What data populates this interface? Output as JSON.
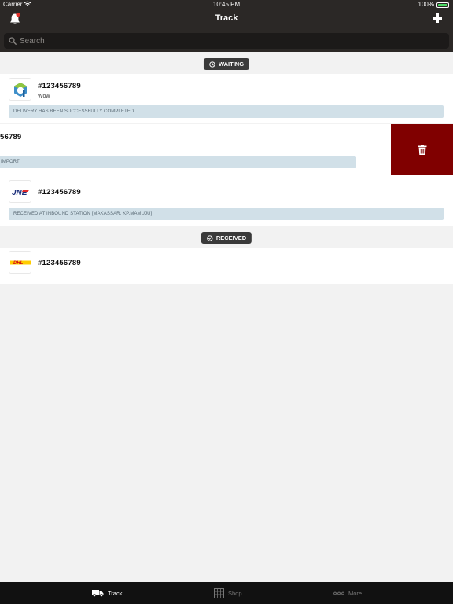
{
  "status_bar": {
    "carrier": "Carrier",
    "time": "10:45 PM",
    "battery": "100%"
  },
  "nav": {
    "title": "Track",
    "bell_icon": "bell-icon",
    "add_icon": "plus-icon"
  },
  "search": {
    "placeholder": "Search"
  },
  "sections": [
    {
      "label": "WAITING",
      "icon": "clock-icon"
    },
    {
      "label": "RECEIVED",
      "icon": "check-circle-icon"
    }
  ],
  "shipments": [
    {
      "tracking": "#123456789",
      "note": "Wow",
      "status": "DELIVERY HAS BEEN SUCCESSFULLY COMPLETED",
      "carrier_logo": "generic-courier-logo"
    },
    {
      "tracking": "56789",
      "status": "IMPORT",
      "carrier_logo": "hidden"
    },
    {
      "tracking": "#123456789",
      "status": "RECEIVED AT INBOUND STATION [MAKASSAR, KP.MAMUJU]",
      "carrier_logo": "jne-logo"
    },
    {
      "tracking": "#123456789",
      "carrier_logo": "dhl-logo"
    }
  ],
  "logos": {
    "jne": "JNE",
    "dhl": "DHL"
  },
  "swipe_action": {
    "icon": "trash-icon",
    "color": "#800000"
  },
  "tabs": [
    {
      "label": "Track",
      "icon": "truck-icon",
      "active": true
    },
    {
      "label": "Shop",
      "icon": "shop-icon",
      "active": false
    },
    {
      "label": "More",
      "icon": "more-icon",
      "active": false
    }
  ],
  "colors": {
    "nav_bg": "#2b2826",
    "badge_bg": "#3a3a3a",
    "status_bg": "#d1e0e8",
    "notification_dot": "#e0302a"
  }
}
